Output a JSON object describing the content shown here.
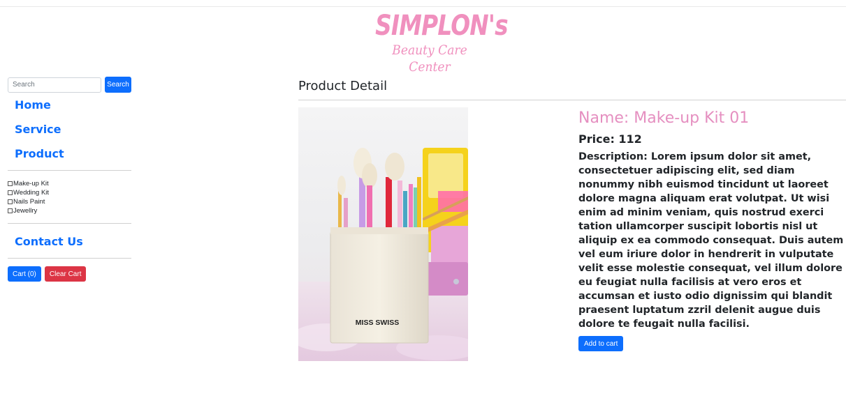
{
  "brand": {
    "title": "SIMPLON's",
    "subtitle": "Beauty Care Center",
    "color": "#f090be"
  },
  "sidebar": {
    "search": {
      "placeholder": "Search",
      "value": "",
      "button_label": "Search"
    },
    "nav": {
      "home": "Home",
      "service": "Service",
      "product": "Product",
      "contact": "Contact Us"
    },
    "filters": [
      {
        "label": "Make-up Kit",
        "checked": false
      },
      {
        "label": "Wedding Kit",
        "checked": false
      },
      {
        "label": "Nails Paint",
        "checked": false
      },
      {
        "label": "Jewellry",
        "checked": false
      }
    ],
    "cart_label": "Cart (0)",
    "clear_cart_label": "Clear Cart"
  },
  "main": {
    "section_title": "Product Detail",
    "product": {
      "image_label": "MISS SWISS",
      "name": "Name: Make-up Kit 01",
      "price": "Price: 112",
      "description": "Description: Lorem ipsum dolor sit amet, consectetuer adipiscing elit, sed diam nonummy nibh euismod tincidunt ut laoreet dolore magna aliquam erat volutpat. Ut wisi enim ad minim veniam, quis nostrud exerci tation ullamcorper suscipit lobortis nisl ut aliquip ex ea commodo consequat. Duis autem vel eum iriure dolor in hendrerit in vulputate velit esse molestie consequat, vel illum dolore eu feugiat nulla facilisis at vero eros et accumsan et iusto odio dignissim qui blandit praesent luptatum zzril delenit augue duis dolore te feugait nulla facilisi.",
      "add_to_cart_label": "Add to cart"
    }
  },
  "colors": {
    "primary": "#0d6efd",
    "danger": "#dc3545",
    "accent_pink": "#e58fc0"
  }
}
